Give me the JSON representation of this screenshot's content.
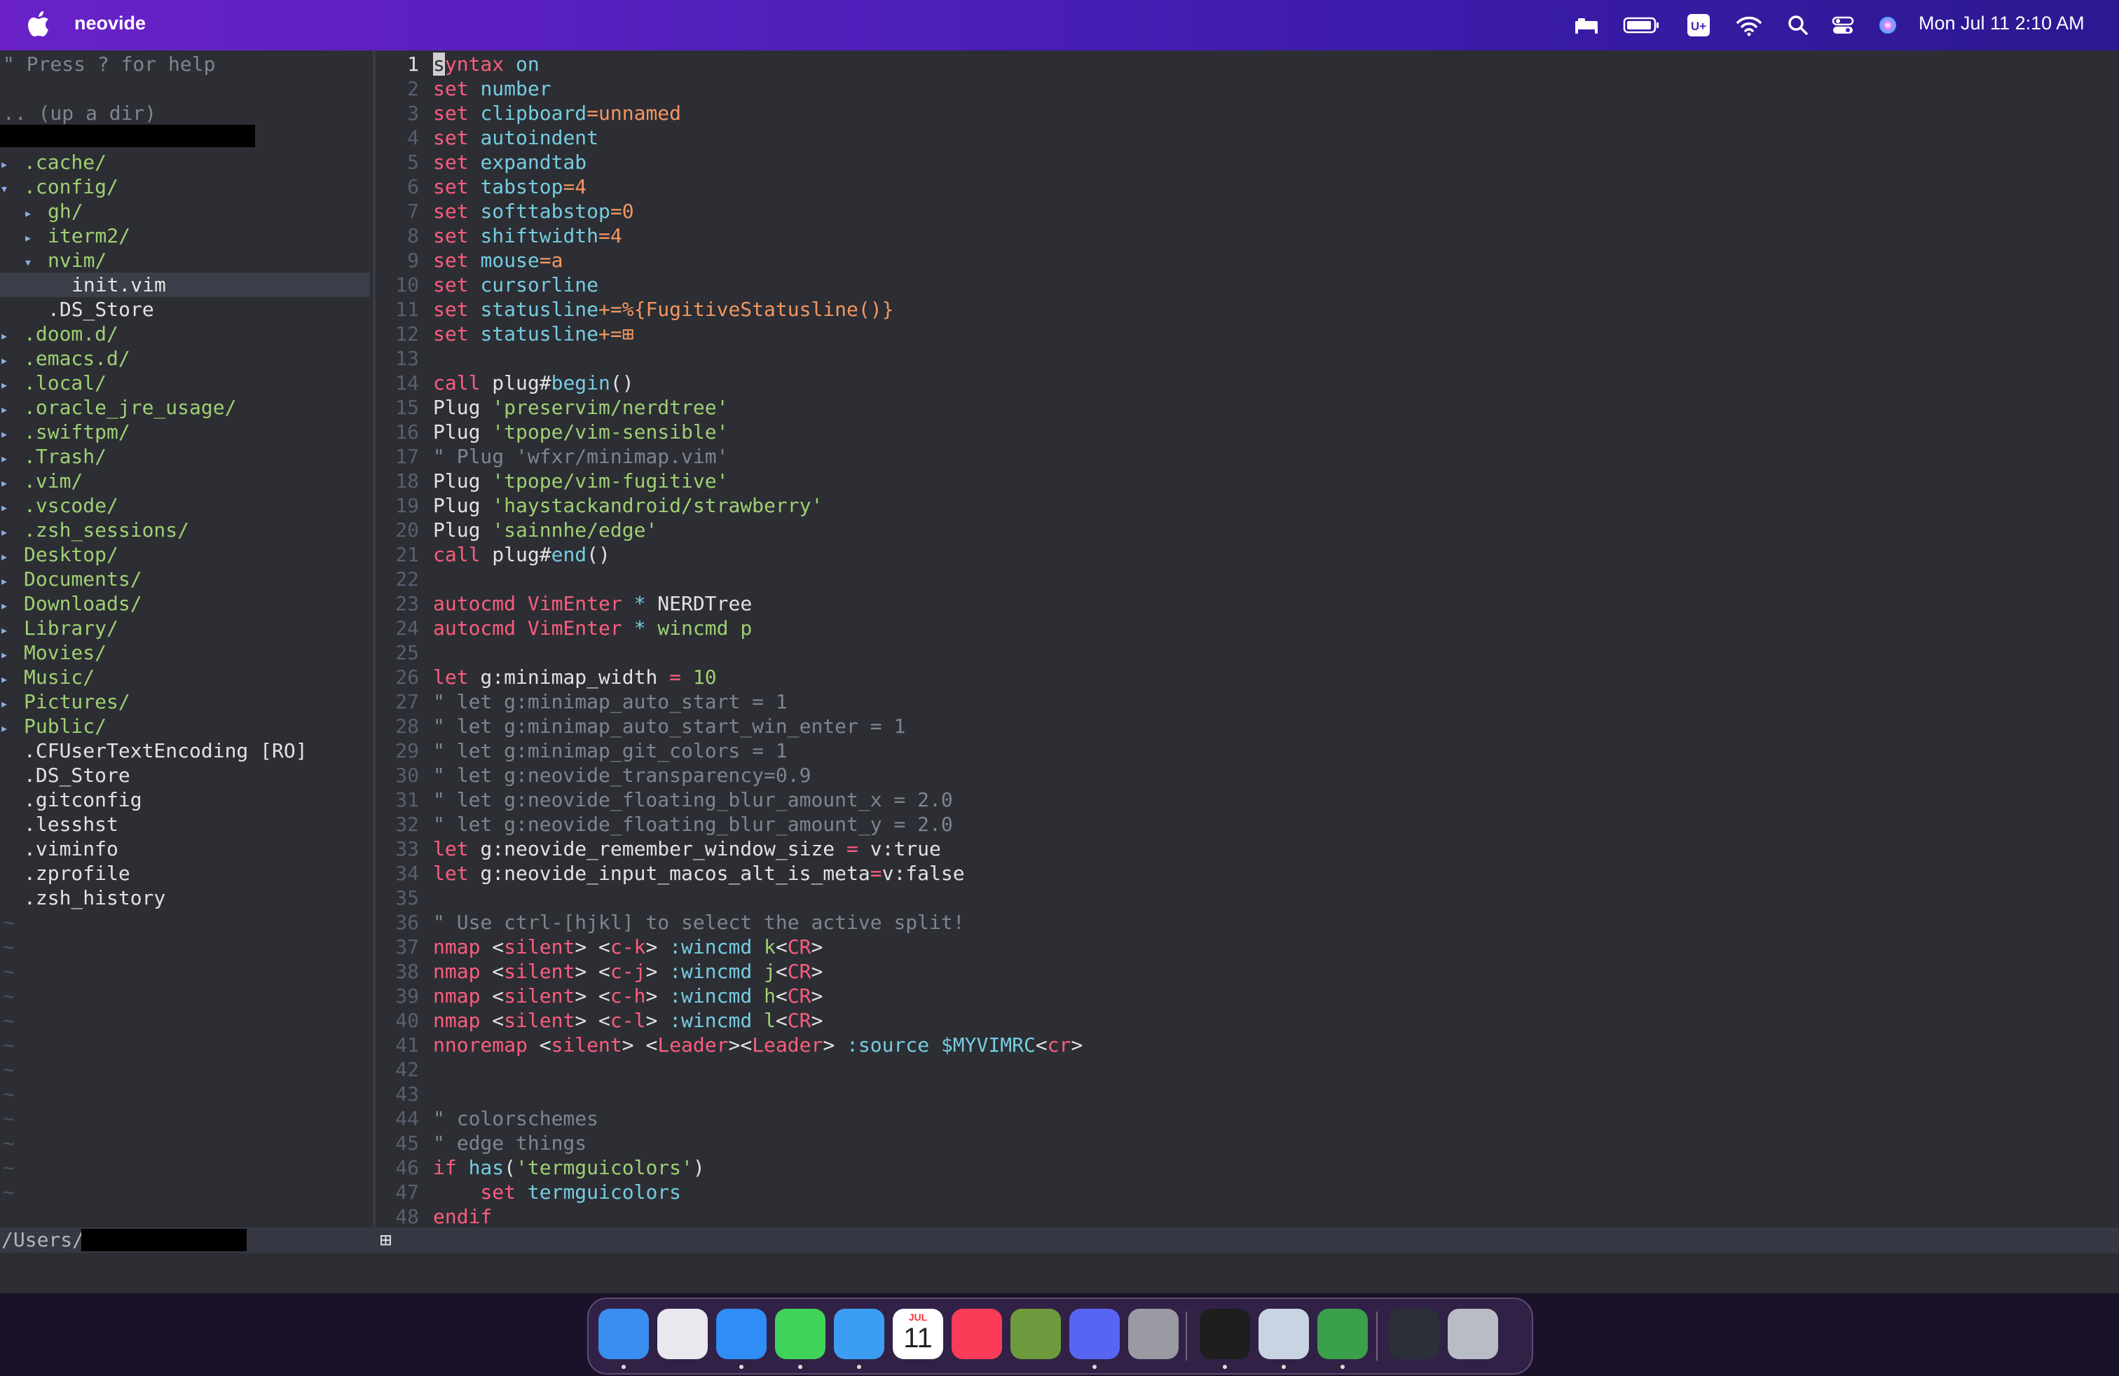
{
  "menubar": {
    "app_name": "neovide",
    "clock": "Mon Jul 11  2:10 AM",
    "icons": [
      "apple-icon",
      "bed-icon",
      "battery-icon",
      "u-plus-icon",
      "wifi-icon",
      "search-icon",
      "control-center-icon",
      "siri-icon"
    ]
  },
  "tree": {
    "help": "\" Press ? for help",
    "up": ".. (up a dir)",
    "items": [
      {
        "label": ".cache/",
        "indent": 0,
        "kind": "dir",
        "expanded": false
      },
      {
        "label": ".config/",
        "indent": 0,
        "kind": "dir",
        "expanded": true
      },
      {
        "label": "gh/",
        "indent": 1,
        "kind": "dir",
        "expanded": false
      },
      {
        "label": "iterm2/",
        "indent": 1,
        "kind": "dir",
        "expanded": false
      },
      {
        "label": "nvim/",
        "indent": 1,
        "kind": "dir",
        "expanded": true
      },
      {
        "label": "init.vim",
        "indent": 2,
        "kind": "file",
        "selected": true
      },
      {
        "label": ".DS_Store",
        "indent": 1,
        "kind": "file"
      },
      {
        "label": ".doom.d/",
        "indent": 0,
        "kind": "dir",
        "expanded": false
      },
      {
        "label": ".emacs.d/",
        "indent": 0,
        "kind": "dir",
        "expanded": false
      },
      {
        "label": ".local/",
        "indent": 0,
        "kind": "dir",
        "expanded": false
      },
      {
        "label": ".oracle_jre_usage/",
        "indent": 0,
        "kind": "dir",
        "expanded": false
      },
      {
        "label": ".swiftpm/",
        "indent": 0,
        "kind": "dir",
        "expanded": false
      },
      {
        "label": ".Trash/",
        "indent": 0,
        "kind": "dir",
        "expanded": false
      },
      {
        "label": ".vim/",
        "indent": 0,
        "kind": "dir",
        "expanded": false
      },
      {
        "label": ".vscode/",
        "indent": 0,
        "kind": "dir",
        "expanded": false
      },
      {
        "label": ".zsh_sessions/",
        "indent": 0,
        "kind": "dir",
        "expanded": false
      },
      {
        "label": "Desktop/",
        "indent": 0,
        "kind": "dir",
        "expanded": false
      },
      {
        "label": "Documents/",
        "indent": 0,
        "kind": "dir",
        "expanded": false
      },
      {
        "label": "Downloads/",
        "indent": 0,
        "kind": "dir",
        "expanded": false
      },
      {
        "label": "Library/",
        "indent": 0,
        "kind": "dir",
        "expanded": false
      },
      {
        "label": "Movies/",
        "indent": 0,
        "kind": "dir",
        "expanded": false
      },
      {
        "label": "Music/",
        "indent": 0,
        "kind": "dir",
        "expanded": false
      },
      {
        "label": "Pictures/",
        "indent": 0,
        "kind": "dir",
        "expanded": false
      },
      {
        "label": "Public/",
        "indent": 0,
        "kind": "dir",
        "expanded": false
      },
      {
        "label": ".CFUserTextEncoding [RO]",
        "indent": 0,
        "kind": "file"
      },
      {
        "label": ".DS_Store",
        "indent": 0,
        "kind": "file"
      },
      {
        "label": ".gitconfig",
        "indent": 0,
        "kind": "file"
      },
      {
        "label": ".lesshst",
        "indent": 0,
        "kind": "file"
      },
      {
        "label": ".viminfo",
        "indent": 0,
        "kind": "file"
      },
      {
        "label": ".zprofile",
        "indent": 0,
        "kind": "file"
      },
      {
        "label": ".zsh_history",
        "indent": 0,
        "kind": "file"
      }
    ],
    "tilde": "~"
  },
  "editor": {
    "lines": [
      [
        [
          "kw",
          "s"
        ],
        [
          "kw",
          "yntax"
        ],
        [
          "pl",
          " "
        ],
        [
          "opt",
          "on"
        ]
      ],
      [
        [
          "kw",
          "set"
        ],
        [
          "pl",
          " "
        ],
        [
          "opt",
          "number"
        ]
      ],
      [
        [
          "kw",
          "set"
        ],
        [
          "pl",
          " "
        ],
        [
          "opt",
          "clipboard"
        ],
        [
          "val",
          "=unnamed"
        ]
      ],
      [
        [
          "kw",
          "set"
        ],
        [
          "pl",
          " "
        ],
        [
          "opt",
          "autoindent"
        ]
      ],
      [
        [
          "kw",
          "set"
        ],
        [
          "pl",
          " "
        ],
        [
          "opt",
          "expandtab"
        ]
      ],
      [
        [
          "kw",
          "set"
        ],
        [
          "pl",
          " "
        ],
        [
          "opt",
          "tabstop"
        ],
        [
          "val",
          "=4"
        ]
      ],
      [
        [
          "kw",
          "set"
        ],
        [
          "pl",
          " "
        ],
        [
          "opt",
          "softtabstop"
        ],
        [
          "val",
          "=0"
        ]
      ],
      [
        [
          "kw",
          "set"
        ],
        [
          "pl",
          " "
        ],
        [
          "opt",
          "shiftwidth"
        ],
        [
          "val",
          "=4"
        ]
      ],
      [
        [
          "kw",
          "set"
        ],
        [
          "pl",
          " "
        ],
        [
          "opt",
          "mouse"
        ],
        [
          "val",
          "=a"
        ]
      ],
      [
        [
          "kw",
          "set"
        ],
        [
          "pl",
          " "
        ],
        [
          "opt",
          "cursorline"
        ]
      ],
      [
        [
          "kw",
          "set"
        ],
        [
          "pl",
          " "
        ],
        [
          "opt",
          "statusline"
        ],
        [
          "val",
          "+=%{FugitiveStatusline()}"
        ]
      ],
      [
        [
          "kw",
          "set"
        ],
        [
          "pl",
          " "
        ],
        [
          "opt",
          "statusline"
        ],
        [
          "val",
          "+=⊞"
        ]
      ],
      [],
      [
        [
          "kw",
          "call"
        ],
        [
          "pl",
          " plug#"
        ],
        [
          "fn",
          "begin"
        ],
        [
          "pl",
          "()"
        ]
      ],
      [
        [
          "pl",
          "Plug "
        ],
        [
          "str",
          "'preservim/nerdtree'"
        ]
      ],
      [
        [
          "pl",
          "Plug "
        ],
        [
          "str",
          "'tpope/vim-sensible'"
        ]
      ],
      [
        [
          "com",
          "\" Plug 'wfxr/minimap.vim'"
        ]
      ],
      [
        [
          "pl",
          "Plug "
        ],
        [
          "str",
          "'tpope/vim-fugitive'"
        ]
      ],
      [
        [
          "pl",
          "Plug "
        ],
        [
          "str",
          "'haystackandroid/strawberry'"
        ]
      ],
      [
        [
          "pl",
          "Plug "
        ],
        [
          "str",
          "'sainnhe/edge'"
        ]
      ],
      [
        [
          "kw",
          "call"
        ],
        [
          "pl",
          " plug#"
        ],
        [
          "fn",
          "end"
        ],
        [
          "pl",
          "()"
        ]
      ],
      [],
      [
        [
          "kw",
          "autocmd"
        ],
        [
          "pl",
          " "
        ],
        [
          "kw",
          "VimEnter"
        ],
        [
          "pl",
          " "
        ],
        [
          "opt",
          "*"
        ],
        [
          "pl",
          " NERDTree"
        ]
      ],
      [
        [
          "kw",
          "autocmd"
        ],
        [
          "pl",
          " "
        ],
        [
          "kw",
          "VimEnter"
        ],
        [
          "pl",
          " "
        ],
        [
          "opt",
          "*"
        ],
        [
          "pl",
          " "
        ],
        [
          "str",
          "wincmd p"
        ]
      ],
      [],
      [
        [
          "kw",
          "let"
        ],
        [
          "pl",
          " g:minimap_width "
        ],
        [
          "kw",
          "="
        ],
        [
          "pl",
          " "
        ],
        [
          "num",
          "10"
        ]
      ],
      [
        [
          "com",
          "\" let g:minimap_auto_start = 1"
        ]
      ],
      [
        [
          "com",
          "\" let g:minimap_auto_start_win_enter = 1"
        ]
      ],
      [
        [
          "com",
          "\" let g:minimap_git_colors = 1"
        ]
      ],
      [
        [
          "com",
          "\" let g:neovide_transparency=0.9"
        ]
      ],
      [
        [
          "com",
          "\" let g:neovide_floating_blur_amount_x = 2.0"
        ]
      ],
      [
        [
          "com",
          "\" let g:neovide_floating_blur_amount_y = 2.0"
        ]
      ],
      [
        [
          "kw",
          "let"
        ],
        [
          "pl",
          " g:neovide_remember_window_size "
        ],
        [
          "kw",
          "="
        ],
        [
          "pl",
          " v:true"
        ]
      ],
      [
        [
          "kw",
          "let"
        ],
        [
          "pl",
          " g:neovide_input_macos_alt_is_meta"
        ],
        [
          "kw",
          "="
        ],
        [
          "pl",
          "v:false"
        ]
      ],
      [],
      [
        [
          "com",
          "\" Use ctrl-[hjkl] to select the active split!"
        ]
      ],
      [
        [
          "kw",
          "nmap"
        ],
        [
          "pl",
          " <"
        ],
        [
          "kw",
          "silent"
        ],
        [
          "pl",
          "> <"
        ],
        [
          "kw",
          "c-k"
        ],
        [
          "pl",
          "> "
        ],
        [
          "fn",
          ":wincmd"
        ],
        [
          "pl",
          " "
        ],
        [
          "str",
          "k"
        ],
        [
          "pl",
          "<"
        ],
        [
          "kw",
          "CR"
        ],
        [
          "pl",
          ">"
        ]
      ],
      [
        [
          "kw",
          "nmap"
        ],
        [
          "pl",
          " <"
        ],
        [
          "kw",
          "silent"
        ],
        [
          "pl",
          "> <"
        ],
        [
          "kw",
          "c-j"
        ],
        [
          "pl",
          "> "
        ],
        [
          "fn",
          ":wincmd"
        ],
        [
          "pl",
          " "
        ],
        [
          "str",
          "j"
        ],
        [
          "pl",
          "<"
        ],
        [
          "kw",
          "CR"
        ],
        [
          "pl",
          ">"
        ]
      ],
      [
        [
          "kw",
          "nmap"
        ],
        [
          "pl",
          " <"
        ],
        [
          "kw",
          "silent"
        ],
        [
          "pl",
          "> <"
        ],
        [
          "kw",
          "c-h"
        ],
        [
          "pl",
          "> "
        ],
        [
          "fn",
          ":wincmd"
        ],
        [
          "pl",
          " "
        ],
        [
          "str",
          "h"
        ],
        [
          "pl",
          "<"
        ],
        [
          "kw",
          "CR"
        ],
        [
          "pl",
          ">"
        ]
      ],
      [
        [
          "kw",
          "nmap"
        ],
        [
          "pl",
          " <"
        ],
        [
          "kw",
          "silent"
        ],
        [
          "pl",
          "> <"
        ],
        [
          "kw",
          "c-l"
        ],
        [
          "pl",
          "> "
        ],
        [
          "fn",
          ":wincmd"
        ],
        [
          "pl",
          " "
        ],
        [
          "str",
          "l"
        ],
        [
          "pl",
          "<"
        ],
        [
          "kw",
          "CR"
        ],
        [
          "pl",
          ">"
        ]
      ],
      [
        [
          "kw",
          "nnoremap"
        ],
        [
          "pl",
          " <"
        ],
        [
          "kw",
          "silent"
        ],
        [
          "pl",
          "> <"
        ],
        [
          "kw",
          "Leader"
        ],
        [
          "pl",
          "><"
        ],
        [
          "kw",
          "Leader"
        ],
        [
          "pl",
          "> "
        ],
        [
          "fn",
          ":source"
        ],
        [
          "pl",
          " "
        ],
        [
          "fn",
          "$MYVIMRC"
        ],
        [
          "pl",
          "<"
        ],
        [
          "kw",
          "cr"
        ],
        [
          "pl",
          ">"
        ]
      ],
      [],
      [],
      [
        [
          "com",
          "\" colorschemes"
        ]
      ],
      [
        [
          "com",
          "\" edge things"
        ]
      ],
      [
        [
          "kw",
          "if"
        ],
        [
          "pl",
          " "
        ],
        [
          "fn",
          "has"
        ],
        [
          "pl",
          "("
        ],
        [
          "str",
          "'termguicolors'"
        ],
        [
          "pl",
          ")"
        ]
      ],
      [
        [
          "pl",
          "    "
        ],
        [
          "kw",
          "set"
        ],
        [
          "pl",
          " "
        ],
        [
          "opt",
          "termguicolors"
        ]
      ],
      [
        [
          "kw",
          "endif"
        ]
      ]
    ]
  },
  "statusbar": {
    "path": "/Users/",
    "indicator": "⊞"
  },
  "dock": {
    "apps": [
      {
        "name": "finder-icon",
        "color": "#3a8ef0",
        "running": true
      },
      {
        "name": "launchpad-icon",
        "color": "#e8e8ee",
        "running": false
      },
      {
        "name": "safari-icon",
        "color": "#2f8df5",
        "running": true
      },
      {
        "name": "messages-icon",
        "color": "#3fd35a",
        "running": true
      },
      {
        "name": "mail-icon",
        "color": "#3c9ef3",
        "running": true
      },
      {
        "name": "calendar-icon",
        "color": "#ffffff",
        "running": false
      },
      {
        "name": "music-icon",
        "color": "#fa3c58",
        "running": false
      },
      {
        "name": "minecraft-icon",
        "color": "#6c9a3c",
        "running": false
      },
      {
        "name": "discord-icon",
        "color": "#5865f2",
        "running": true
      },
      {
        "name": "system-preferences-icon",
        "color": "#9a9aa2",
        "running": false
      },
      {
        "name": "terminal-icon",
        "color": "#1e1e1e",
        "running": true
      },
      {
        "name": "preview-icon",
        "color": "#c9d4e2",
        "running": true
      },
      {
        "name": "neovide-icon",
        "color": "#3aa04a",
        "running": true
      },
      {
        "name": "downloads-stack-icon",
        "color": "#2a2f38",
        "running": false
      },
      {
        "name": "trash-icon",
        "color": "#b8bcc4",
        "running": false
      }
    ],
    "calendar_month": "JUL",
    "calendar_day": "11"
  }
}
